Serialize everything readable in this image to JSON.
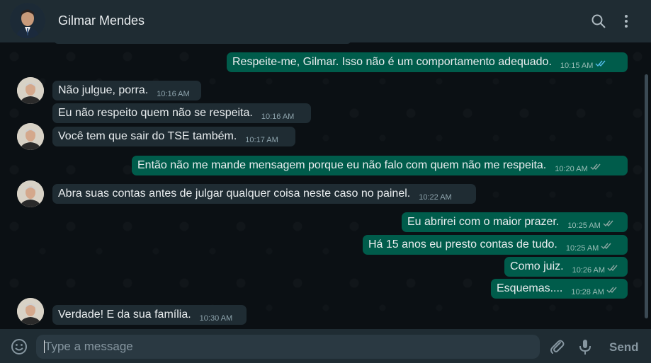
{
  "header": {
    "title": "Gilmar Mendes"
  },
  "messages": [
    {
      "direction": "out",
      "text": "Respeite-me, Gilmar. Isso não é um comportamento adequado.",
      "time": "10:15 AM",
      "status": "read"
    },
    {
      "direction": "in",
      "text": "Não julgue, porra.",
      "time": "10:16 AM"
    },
    {
      "direction": "in",
      "text": "Eu não respeito quem não se respeita.",
      "time": "10:16 AM"
    },
    {
      "direction": "in",
      "text": "Você tem que sair do TSE também.",
      "time": "10:17 AM"
    },
    {
      "direction": "out",
      "text": "Então não me mande mensagem porque eu não falo com quem não me respeita.",
      "time": "10:20 AM",
      "status": "delivered"
    },
    {
      "direction": "in",
      "text": "Abra suas contas antes de julgar qualquer coisa neste caso no painel.",
      "time": "10:22 AM"
    },
    {
      "direction": "out",
      "text": "Eu abrirei com o maior prazer.",
      "time": "10:25 AM",
      "status": "delivered"
    },
    {
      "direction": "out",
      "text": "Há 15 anos eu presto contas de tudo.",
      "time": "10:25 AM",
      "status": "delivered"
    },
    {
      "direction": "out",
      "text": "Como juiz.",
      "time": "10:26 AM",
      "status": "delivered"
    },
    {
      "direction": "out",
      "text": "Esquemas....",
      "time": "10:28 AM",
      "status": "delivered"
    },
    {
      "direction": "in",
      "text": "Verdade! E da sua família.",
      "time": "10:30 AM"
    }
  ],
  "composer": {
    "placeholder": "Type a message",
    "value": "",
    "send_label": "Send"
  },
  "colors": {
    "header_bg": "#1f2c33",
    "incoming_bubble": "#1f2c33",
    "outgoing_bubble": "#005c4b",
    "read_tick": "#53bdeb",
    "delivered_tick": "#8aa7a1"
  }
}
